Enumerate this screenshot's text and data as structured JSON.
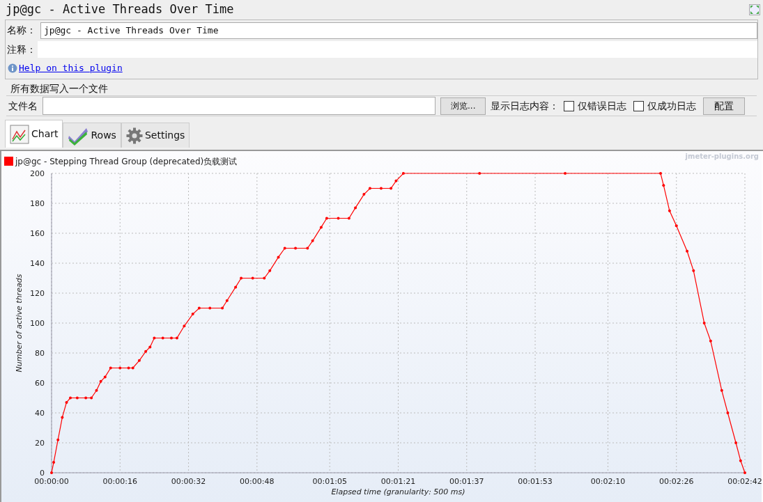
{
  "title": "jp@gc - Active Threads Over Time",
  "name_field": {
    "label": "名称：",
    "value": "jp@gc - Active Threads Over Time"
  },
  "comment_field": {
    "label": "注释："
  },
  "help_link": "Help on this plugin",
  "file_group": {
    "title": "所有数据写入一个文件",
    "file_label": "文件名",
    "browse_button": "浏览...",
    "log_label": "显示日志内容：",
    "checkboxes": [
      {
        "label": "仅错误日志",
        "checked": false
      },
      {
        "label": "仅成功日志",
        "checked": false
      }
    ],
    "config_button": "配置"
  },
  "tabs": [
    {
      "label": "Chart",
      "kind": "chart",
      "selected": true
    },
    {
      "label": "Rows",
      "kind": "rows",
      "selected": false
    },
    {
      "label": "Settings",
      "kind": "settings",
      "selected": false
    }
  ],
  "chart": {
    "watermark": "jmeter-plugins.org",
    "chart_data": {
      "type": "line",
      "xlabel": "Elapsed time (granularity: 500 ms)",
      "ylabel": "Number of active threads",
      "x": [
        0,
        0.5,
        1.5,
        2.5,
        3.5,
        4.4,
        6,
        8,
        9.3,
        10.5,
        11.5,
        12.5,
        13.8,
        16,
        18,
        19,
        20.5,
        22,
        23,
        24,
        26,
        28,
        29.3,
        31,
        33,
        34.5,
        37,
        39.9,
        41,
        43,
        44.3,
        47,
        49.7,
        51,
        53,
        54.5,
        57,
        59.8,
        61,
        63,
        64.3,
        67,
        69.5,
        71,
        73,
        74.4,
        77,
        79.3,
        80.5,
        82.2,
        100,
        120,
        142.3,
        143,
        144.4,
        146,
        148.5,
        150,
        152.5,
        154,
        156.6,
        158,
        159.9,
        161,
        162
      ],
      "series": [
        {
          "name": "jp@gc - Stepping Thread Group (deprecated)负载测试",
          "color": "#ff0000",
          "values": [
            0,
            7,
            22,
            37,
            47,
            50,
            50,
            50,
            50,
            55,
            61,
            64,
            70,
            70,
            70,
            70,
            75,
            81,
            84,
            90,
            90,
            90,
            90,
            98,
            106,
            110,
            110,
            110,
            115,
            124,
            130,
            130,
            130,
            135,
            144,
            150,
            150,
            150,
            155,
            164,
            170,
            170,
            170,
            177,
            186,
            190,
            190,
            190,
            195,
            200,
            200,
            200,
            200,
            192,
            175,
            165,
            148,
            135,
            100,
            88,
            55,
            40,
            20,
            8,
            0
          ]
        }
      ],
      "xlim": [
        0,
        162
      ],
      "ylim": [
        0,
        200
      ],
      "grid": true,
      "xticks": [
        {
          "value": 0,
          "label": "00:00:00"
        },
        {
          "value": 16,
          "label": "00:00:16"
        },
        {
          "value": 32,
          "label": "00:00:32"
        },
        {
          "value": 48,
          "label": "00:00:48"
        },
        {
          "value": 65,
          "label": "00:01:05"
        },
        {
          "value": 81,
          "label": "00:01:21"
        },
        {
          "value": 97,
          "label": "00:01:37"
        },
        {
          "value": 113,
          "label": "00:01:53"
        },
        {
          "value": 130,
          "label": "00:02:10"
        },
        {
          "value": 146,
          "label": "00:02:26"
        },
        {
          "value": 162,
          "label": "00:02:42"
        }
      ],
      "yticks": [
        0,
        20,
        40,
        60,
        80,
        100,
        120,
        140,
        160,
        180,
        200
      ]
    }
  }
}
